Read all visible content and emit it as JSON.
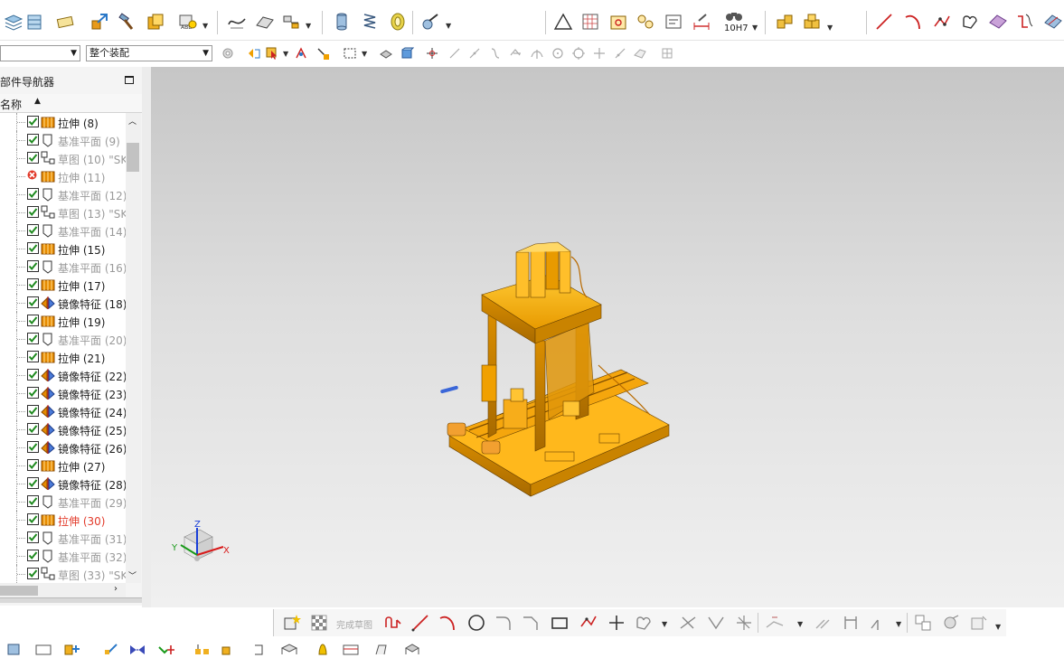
{
  "window": {
    "toolbar_combo_left": "",
    "toolbar_combo_assembly": "整个装配",
    "dimension_label": "10H7"
  },
  "navigator": {
    "title": "部件导航器",
    "column_header": "名称",
    "items": [
      {
        "label": "拉伸 (8)",
        "type": "extrude",
        "state": "checked",
        "style": "normal"
      },
      {
        "label": "基准平面 (9)",
        "type": "datum-plane",
        "state": "checked",
        "style": "dim"
      },
      {
        "label": "草图 (10) \"SK",
        "type": "sketch",
        "state": "checked",
        "style": "dim"
      },
      {
        "label": "拉伸 (11)",
        "type": "extrude",
        "state": "error",
        "style": "dim"
      },
      {
        "label": "基准平面 (12)",
        "type": "datum-plane",
        "state": "checked",
        "style": "dim"
      },
      {
        "label": "草图 (13) \"SK",
        "type": "sketch",
        "state": "checked",
        "style": "dim"
      },
      {
        "label": "基准平面 (14)",
        "type": "datum-plane",
        "state": "checked",
        "style": "dim"
      },
      {
        "label": "拉伸 (15)",
        "type": "extrude",
        "state": "checked",
        "style": "normal"
      },
      {
        "label": "基准平面 (16)",
        "type": "datum-plane",
        "state": "checked",
        "style": "dim"
      },
      {
        "label": "拉伸 (17)",
        "type": "extrude",
        "state": "checked",
        "style": "normal"
      },
      {
        "label": "镜像特征 (18)",
        "type": "mirror",
        "state": "checked",
        "style": "normal"
      },
      {
        "label": "拉伸 (19)",
        "type": "extrude",
        "state": "checked",
        "style": "normal"
      },
      {
        "label": "基准平面 (20)",
        "type": "datum-plane",
        "state": "checked",
        "style": "dim"
      },
      {
        "label": "拉伸 (21)",
        "type": "extrude",
        "state": "checked",
        "style": "normal"
      },
      {
        "label": "镜像特征 (22)",
        "type": "mirror",
        "state": "checked",
        "style": "normal"
      },
      {
        "label": "镜像特征 (23)",
        "type": "mirror",
        "state": "checked",
        "style": "normal"
      },
      {
        "label": "镜像特征 (24)",
        "type": "mirror",
        "state": "checked",
        "style": "normal"
      },
      {
        "label": "镜像特征 (25)",
        "type": "mirror",
        "state": "checked",
        "style": "normal"
      },
      {
        "label": "镜像特征 (26)",
        "type": "mirror",
        "state": "checked",
        "style": "normal"
      },
      {
        "label": "拉伸 (27)",
        "type": "extrude",
        "state": "checked",
        "style": "normal"
      },
      {
        "label": "镜像特征 (28)",
        "type": "mirror",
        "state": "checked",
        "style": "normal"
      },
      {
        "label": "基准平面 (29)",
        "type": "datum-plane",
        "state": "checked",
        "style": "dim"
      },
      {
        "label": "拉伸 (30)",
        "type": "extrude",
        "state": "checked",
        "style": "red"
      },
      {
        "label": "基准平面 (31)",
        "type": "datum-plane",
        "state": "checked",
        "style": "dim"
      },
      {
        "label": "基准平面 (32)",
        "type": "datum-plane",
        "state": "checked",
        "style": "dim"
      },
      {
        "label": "草图 (33) \"SK",
        "type": "sketch",
        "state": "checked",
        "style": "dim"
      }
    ]
  },
  "viewport": {
    "triad": {
      "x_label": "X",
      "y_label": "Y",
      "z_label": "Z"
    },
    "model_color": "#f0a800"
  },
  "sketch_toolbar": {
    "finish_sketch_label": "完成草图"
  },
  "colors": {
    "accent_check": "#1e8a1e",
    "error_red": "#e23a2a",
    "icon_orange": "#e58a00"
  }
}
